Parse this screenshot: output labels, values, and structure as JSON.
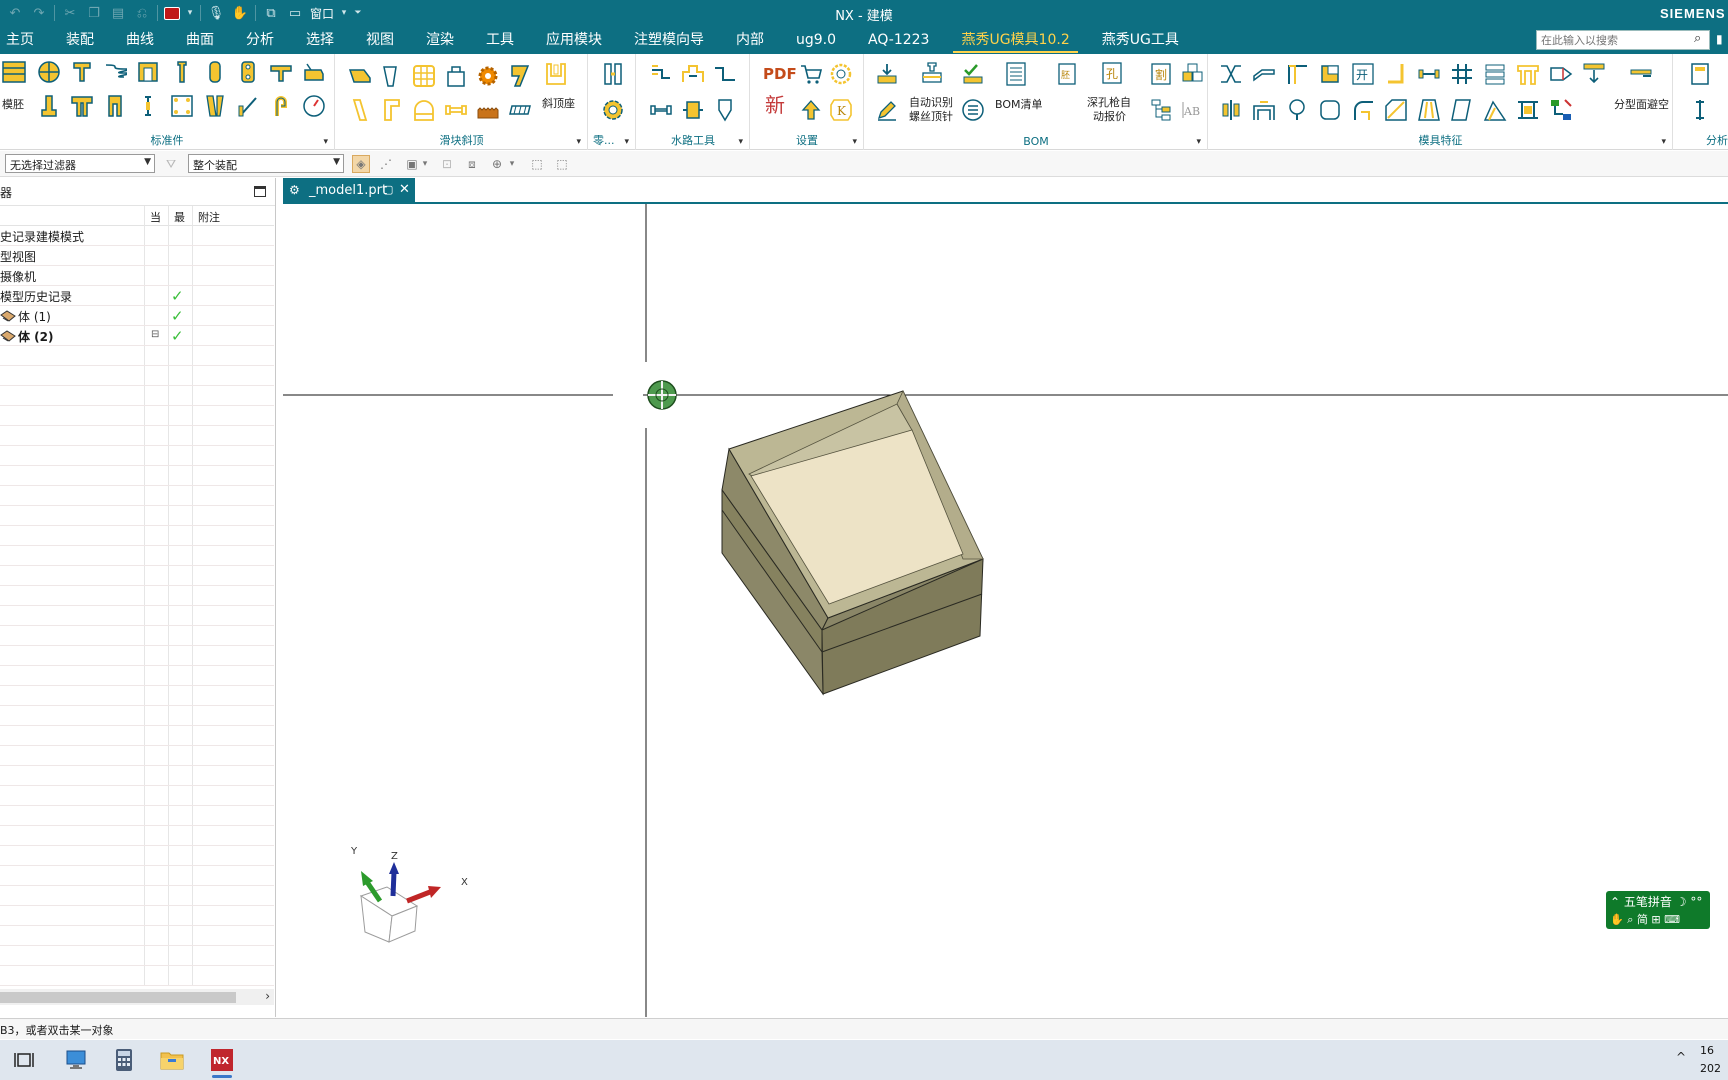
{
  "titlebar": {
    "title": "NX - 建模",
    "brand": "SIEMENS",
    "window_menu": "窗口"
  },
  "menu": {
    "tabs": [
      "主页",
      "装配",
      "曲线",
      "曲面",
      "分析",
      "选择",
      "视图",
      "渲染",
      "工具",
      "应用模块",
      "注塑模向导",
      "内部",
      "ug9.0",
      "AQ-1223",
      "燕秀UG模具10.2",
      "燕秀UG工具"
    ],
    "active_tab": "燕秀UG模具10.2",
    "search_placeholder": "在此输入以搜索"
  },
  "ribbon": {
    "groups": {
      "standard_parts": "标准件",
      "slider_lifter": "滑块斜顶",
      "parts": "零...",
      "waterline": "水路工具",
      "settings": "设置",
      "bom": "BOM",
      "mold_features": "模具特征",
      "analysis": "分析"
    },
    "items": {
      "mold_base": "模胚",
      "lifter_seat": "斜顶座",
      "auto_identify_line1": "自动识别",
      "auto_identify_line2": "螺丝顶针",
      "bom_list": "BOM清单",
      "deep_hole_line1": "深孔枪自",
      "deep_hole_line2": "动报价",
      "parting_avoid": "分型面避空",
      "pdf": "PDF",
      "new_char": "新",
      "hole_char": "孔",
      "cut_char": "割",
      "open_char": "开",
      "k_char": "K"
    }
  },
  "selection_bar": {
    "filter": "无选择过滤器",
    "scope": "整个装配"
  },
  "navigator": {
    "title": "器",
    "columns": {
      "name": "",
      "current": "当",
      "latest": "最",
      "note": "附注"
    },
    "rows": [
      {
        "label": "史记录建模模式",
        "bold": false,
        "check": false,
        "current": false
      },
      {
        "label": "型视图",
        "bold": false,
        "check": false,
        "current": false
      },
      {
        "label": "摄像机",
        "bold": false,
        "check": false,
        "current": false
      },
      {
        "label": "模型历史记录",
        "bold": false,
        "check": true,
        "current": false
      },
      {
        "label": "体 (1)",
        "bold": false,
        "check": true,
        "current": false,
        "icon": true
      },
      {
        "label": "体 (2)",
        "bold": true,
        "check": true,
        "current": true,
        "icon": true
      }
    ]
  },
  "file_tab": {
    "name": "_model1.prt"
  },
  "triad": {
    "x": "X",
    "y": "Y",
    "z": "Z"
  },
  "status": {
    "prompt": "B3，或者双击某一对象"
  },
  "ime": {
    "mode": "五笔拼音",
    "row2": "简 ⊞"
  },
  "clock": {
    "time": "16",
    "date": "202"
  },
  "colors": {
    "theme": "#0d6f82",
    "active_tab": "#ffd24a",
    "ribbon_icon": "#e2a800",
    "ribbon_outline": "#0d5f79",
    "box_side": "#8a8668",
    "box_top": "#ede3c6"
  }
}
